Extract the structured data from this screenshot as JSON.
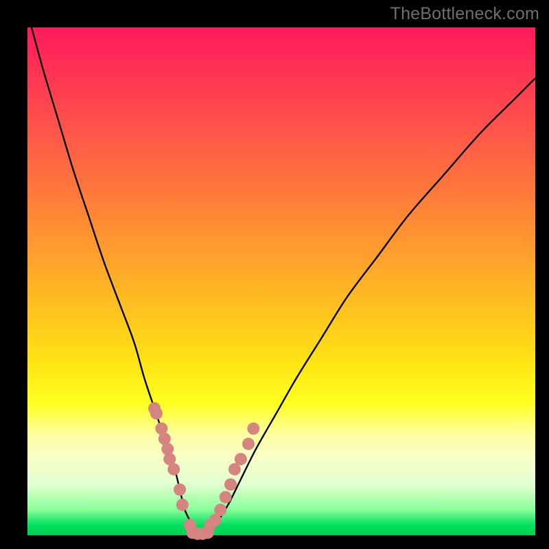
{
  "watermark": "TheBottleneck.com",
  "colors": {
    "curve": "#000000",
    "marker_fill": "#d58480",
    "marker_stroke": "#c06864"
  },
  "chart_data": {
    "type": "line",
    "title": "",
    "xlabel": "",
    "ylabel": "",
    "xlim": [
      0,
      100
    ],
    "ylim": [
      0,
      100
    ],
    "grid": false,
    "legend": false,
    "series": [
      {
        "name": "bottleneck-curve",
        "x": [
          0,
          3,
          6,
          9,
          12,
          15,
          18,
          21,
          23,
          25,
          27,
          29,
          30,
          31,
          32.5,
          34,
          35.5,
          37,
          39.5,
          42,
          45,
          49,
          53,
          58,
          63,
          69,
          75,
          82,
          89,
          96,
          100
        ],
        "y": [
          103,
          92,
          82,
          72,
          63,
          54,
          46,
          38,
          31,
          25,
          19,
          13,
          9,
          5,
          2,
          0,
          0,
          2,
          6,
          11,
          17,
          24,
          31,
          39,
          47,
          55,
          63,
          71,
          79,
          86,
          90
        ]
      }
    ],
    "markers": {
      "left_cluster": {
        "x": [
          25.0,
          25.4,
          26.4,
          27.0,
          27.6,
          28.0,
          28.8,
          30.0,
          30.5,
          32.0
        ],
        "y": [
          25.0,
          24.0,
          21.0,
          19.0,
          17.0,
          15.0,
          13.0,
          9.0,
          6.0,
          2.0
        ]
      },
      "right_cluster": {
        "x": [
          36.0,
          37.0,
          38.0,
          39.0,
          40.0,
          40.8,
          42.0,
          43.5,
          44.5
        ],
        "y": [
          2.0,
          3.0,
          5.0,
          7.5,
          10.0,
          13.0,
          15.0,
          18.0,
          21.0
        ]
      },
      "valley": {
        "x": [
          32.5,
          33.5,
          34.5,
          35.5
        ],
        "y": [
          0.5,
          0.3,
          0.3,
          0.5
        ]
      }
    }
  }
}
